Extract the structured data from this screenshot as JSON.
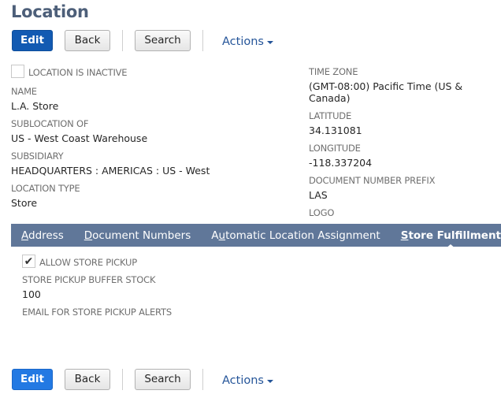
{
  "page": {
    "title": "Location"
  },
  "toolbar": {
    "edit_label": "Edit",
    "back_label": "Back",
    "search_label": "Search",
    "actions_label": "Actions"
  },
  "fields_left": {
    "inactive": {
      "label": "LOCATION IS INACTIVE",
      "checked": false
    },
    "name": {
      "label": "NAME",
      "value": "L.A. Store"
    },
    "sublocation": {
      "label": "SUBLOCATION OF",
      "value": "US - West Coast Warehouse"
    },
    "subsidiary": {
      "label": "SUBSIDIARY",
      "value": "HEADQUARTERS : AMERICAS : US - West"
    },
    "location_type": {
      "label": "LOCATION TYPE",
      "value": "Store"
    }
  },
  "fields_right": {
    "time_zone": {
      "label": "TIME ZONE",
      "value": "(GMT-08:00) Pacific Time (US & Canada)"
    },
    "latitude": {
      "label": "LATITUDE",
      "value": "34.131081"
    },
    "longitude": {
      "label": "LONGITUDE",
      "value": "-118.337204"
    },
    "doc_prefix": {
      "label": "DOCUMENT NUMBER PREFIX",
      "value": "LAS"
    },
    "logo": {
      "label": "LOGO",
      "value": ""
    }
  },
  "tabs": [
    {
      "accesskey": "A",
      "rest": "ddress",
      "label": "Address",
      "active": false
    },
    {
      "accesskey": "D",
      "rest": "ocument Numbers",
      "label": "Document Numbers",
      "active": false
    },
    {
      "pre": "A",
      "accesskey": "u",
      "rest": "tomatic Location Assignment",
      "label": "Automatic Location Assignment",
      "active": false
    },
    {
      "accesskey": "S",
      "rest": "tore Fulfillment",
      "label": "Store Fulfillment",
      "active": true
    }
  ],
  "store_fulfillment": {
    "allow_pickup": {
      "label": "ALLOW STORE PICKUP",
      "checked": true,
      "check_glyph": "✔"
    },
    "buffer_stock": {
      "label": "STORE PICKUP BUFFER STOCK",
      "value": "100"
    },
    "email_alerts": {
      "label": "EMAIL FOR STORE PICKUP ALERTS",
      "value": ""
    }
  }
}
